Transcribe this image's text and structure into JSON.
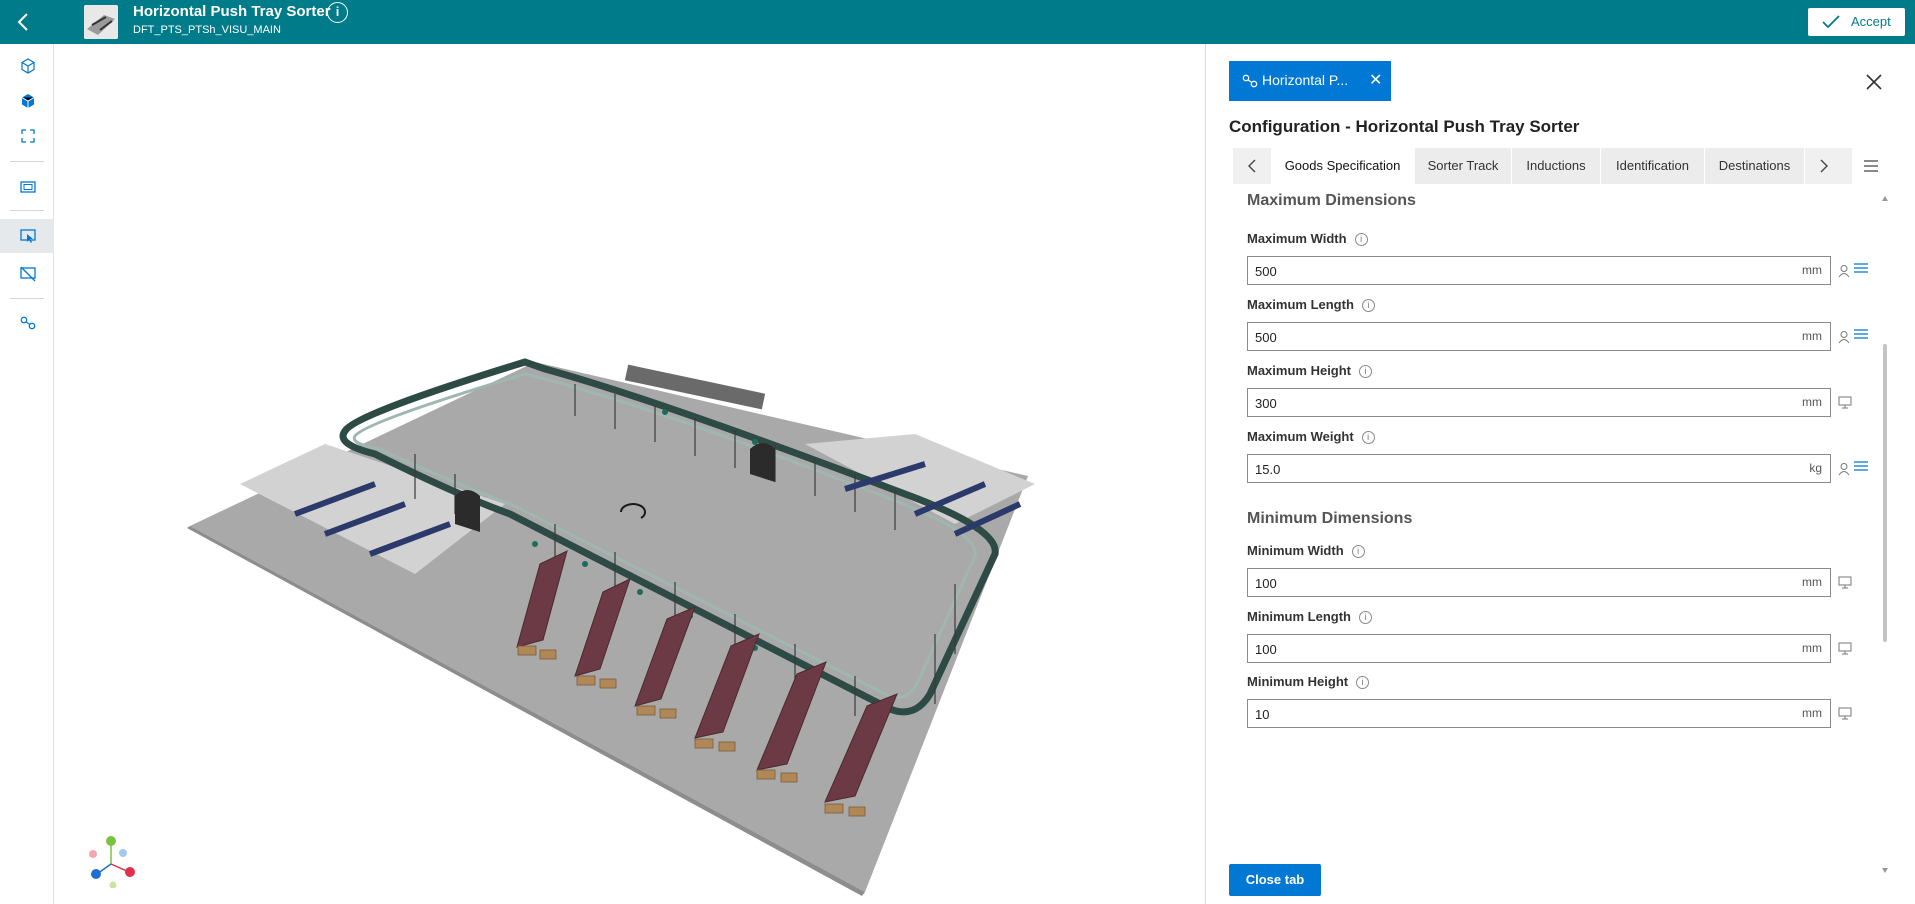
{
  "header": {
    "title": "Horizontal Push Tray Sorter",
    "subtitle": "DFT_PTS_PTSh_VISU_MAIN",
    "info_glyph": "i",
    "accept_label": "Accept"
  },
  "toolbar": {
    "icons": [
      "cube-outline-icon",
      "cube-solid-icon",
      "fit-view-icon",
      "frame-icon",
      "select-view-icon",
      "hide-view-icon",
      "connections-icon"
    ]
  },
  "panel": {
    "doc_tab_label": "Horizontal P...",
    "doc_tab_close": "✕",
    "title": "Configuration - Horizontal Push Tray Sorter",
    "tabs": [
      "Goods Specification",
      "Sorter Track",
      "Inductions",
      "Identification",
      "Destinations"
    ],
    "active_tab": "Goods Specification",
    "sections": {
      "max_title": "Maximum Dimensions",
      "min_title": "Minimum Dimensions"
    },
    "fields": {
      "max_width": {
        "label": "Maximum Width",
        "value": "500",
        "unit": "mm"
      },
      "max_length": {
        "label": "Maximum Length",
        "value": "500",
        "unit": "mm"
      },
      "max_height": {
        "label": "Maximum Height",
        "value": "300",
        "unit": "mm"
      },
      "max_weight": {
        "label": "Maximum Weight",
        "value": "15.0",
        "unit": "kg"
      },
      "min_width": {
        "label": "Minimum Width",
        "value": "100",
        "unit": "mm"
      },
      "min_length": {
        "label": "Minimum Length",
        "value": "100",
        "unit": "mm"
      },
      "min_height": {
        "label": "Minimum Height",
        "value": "10",
        "unit": "mm"
      }
    },
    "info_glyph": "i",
    "close_tab_label": "Close tab"
  },
  "colors": {
    "header_bg": "#007b8a",
    "accent_blue": "#0078d4",
    "chute_red": "#6b3a44",
    "track_green": "#1f6b5a"
  }
}
